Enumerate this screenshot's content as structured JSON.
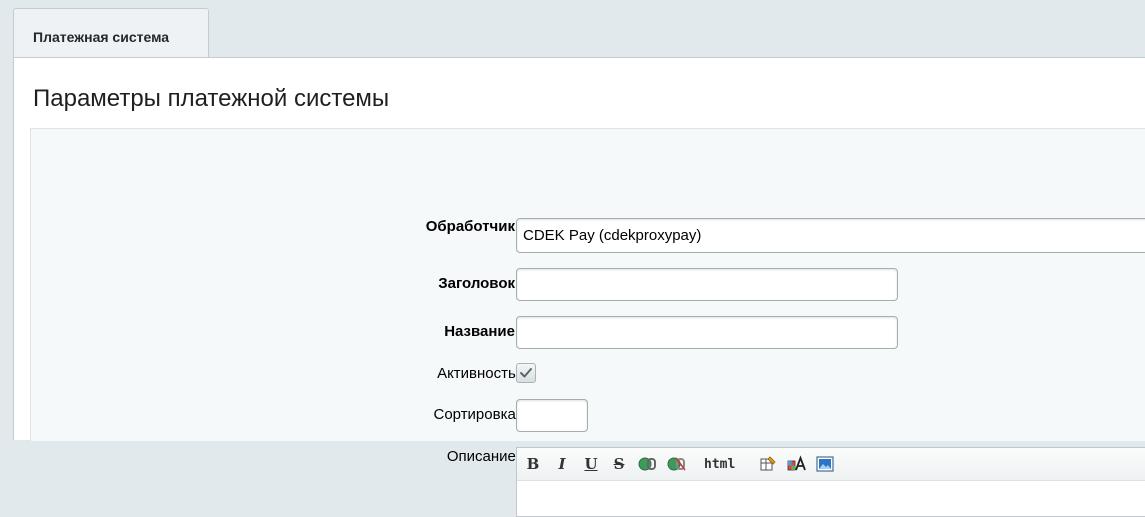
{
  "tabs": [
    {
      "label": "Платежная система"
    }
  ],
  "panel": {
    "title": "Параметры платежной системы"
  },
  "form": {
    "handler": {
      "label": "Обработчик:",
      "value": "CDEK Pay (cdekproxypay)"
    },
    "header": {
      "label": "Заголовок:",
      "value": ""
    },
    "name": {
      "label": "Название:",
      "value": ""
    },
    "active": {
      "label": "Активность:",
      "checked": true
    },
    "sort": {
      "label": "Сортировка:",
      "value": ""
    },
    "description": {
      "label": "Описание:"
    }
  },
  "editor_toolbar": {
    "bold": "B",
    "italic": "I",
    "underline": "U",
    "strike": "S",
    "html": "html"
  },
  "colors": {
    "background": "#e1e9ec",
    "panel": "#ffffff",
    "form_area": "#f5f9f9",
    "border": "#c3ccd1"
  }
}
